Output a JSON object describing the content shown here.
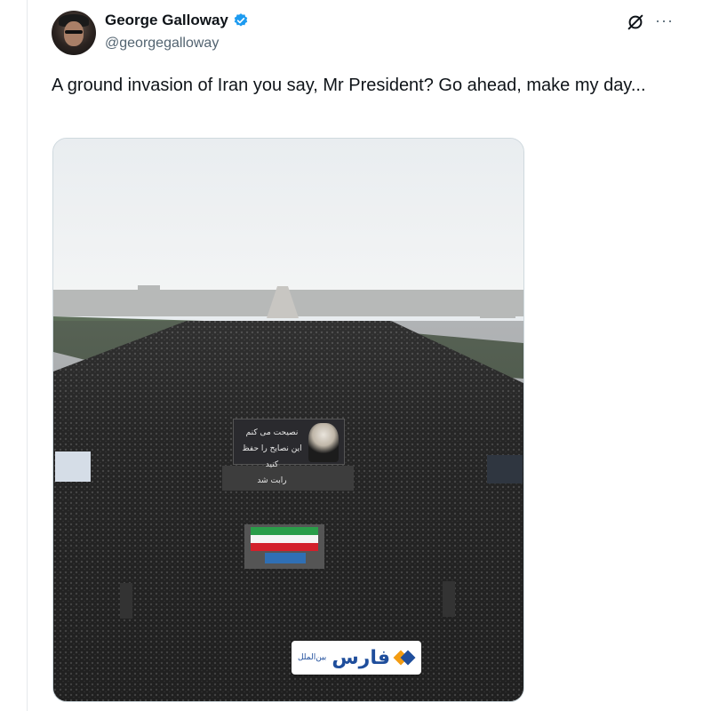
{
  "author": {
    "display_name": "George Galloway",
    "handle": "@georgegalloway",
    "verified": true
  },
  "header_icons": {
    "grok": "grok-icon",
    "more": "more-icon",
    "more_glyph": "···"
  },
  "tweet": {
    "text": "A ground invasion of Iran you say, Mr President? Go ahead, make my day..."
  },
  "media": {
    "banner_text": "نصيحت می کنم اين نصايح را حفظ کنيد",
    "banner_text_2": "رابت شد",
    "watermark_name": "فارس",
    "watermark_sub": "بین‌الملل"
  },
  "colors": {
    "text_primary": "#0f1419",
    "text_secondary": "#536471",
    "verified_blue": "#1d9bf0",
    "fars_blue": "#1f4e9c",
    "fars_orange": "#f39c12"
  }
}
